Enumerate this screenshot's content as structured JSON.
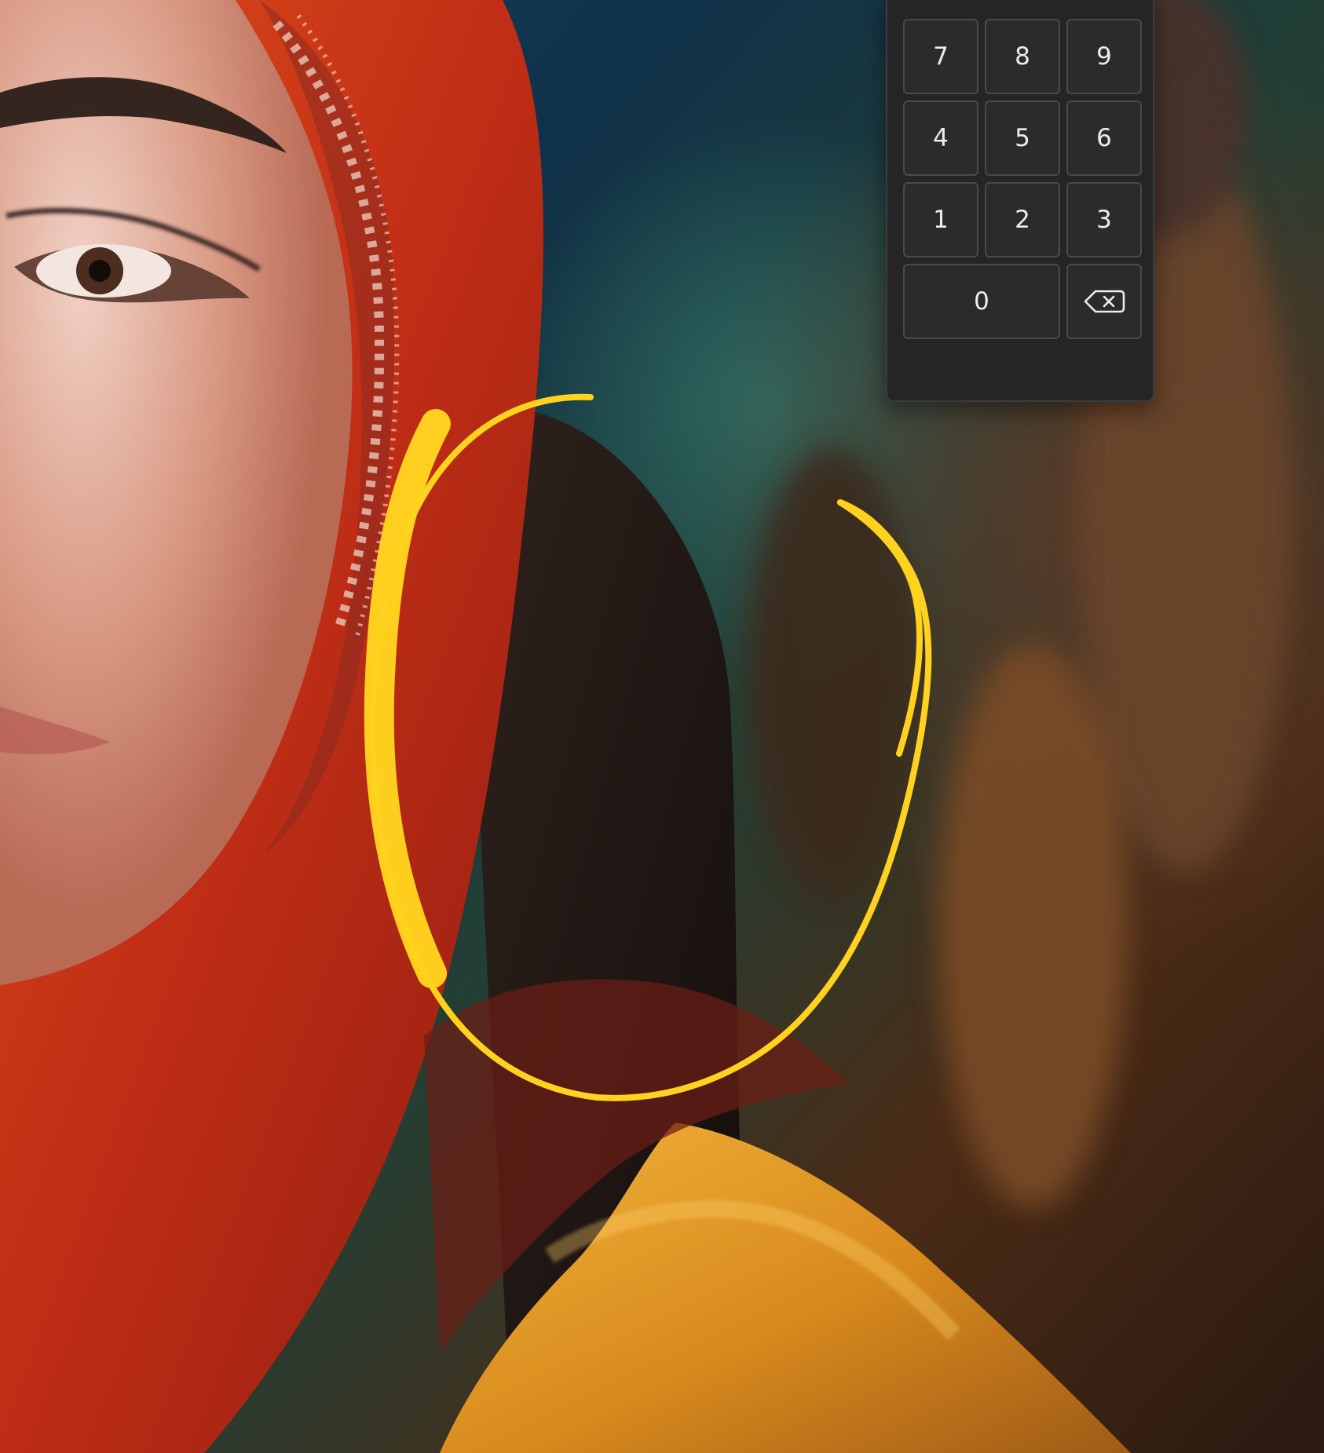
{
  "keypad": {
    "keys": [
      "7",
      "8",
      "9",
      "4",
      "5",
      "6",
      "1",
      "2",
      "3",
      "0"
    ],
    "backspace_icon": "backspace-icon"
  },
  "colors": {
    "panel_bg": "#252525",
    "key_bg": "#2b2b2b",
    "key_border": "#4a4a4a",
    "key_text": "#ececec",
    "annotation_stroke": "#ffd21f",
    "scarf_red": "#c52f16",
    "robe_orange": "#d88a1d"
  }
}
